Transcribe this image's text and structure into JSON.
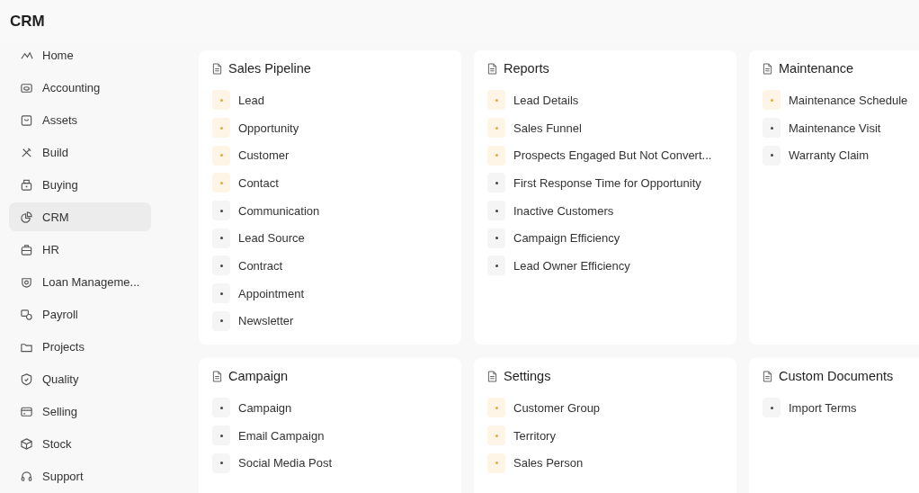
{
  "header": {
    "title": "CRM"
  },
  "sidebar": {
    "items": [
      {
        "label": "Home",
        "selected": false
      },
      {
        "label": "Accounting",
        "selected": false
      },
      {
        "label": "Assets",
        "selected": false
      },
      {
        "label": "Build",
        "selected": false
      },
      {
        "label": "Buying",
        "selected": false
      },
      {
        "label": "CRM",
        "selected": true
      },
      {
        "label": "HR",
        "selected": false
      },
      {
        "label": "Loan Manageme...",
        "selected": false
      },
      {
        "label": "Payroll",
        "selected": false
      },
      {
        "label": "Projects",
        "selected": false
      },
      {
        "label": "Quality",
        "selected": false
      },
      {
        "label": "Selling",
        "selected": false
      },
      {
        "label": "Stock",
        "selected": false
      },
      {
        "label": "Support",
        "selected": false
      }
    ]
  },
  "cards": [
    {
      "title": "Sales Pipeline",
      "links": [
        {
          "label": "Lead",
          "highlighted": true
        },
        {
          "label": "Opportunity",
          "highlighted": true
        },
        {
          "label": "Customer",
          "highlighted": true
        },
        {
          "label": "Contact",
          "highlighted": true
        },
        {
          "label": "Communication",
          "highlighted": false
        },
        {
          "label": "Lead Source",
          "highlighted": false
        },
        {
          "label": "Contract",
          "highlighted": false
        },
        {
          "label": "Appointment",
          "highlighted": false
        },
        {
          "label": "Newsletter",
          "highlighted": false
        }
      ]
    },
    {
      "title": "Reports",
      "links": [
        {
          "label": "Lead Details",
          "highlighted": true
        },
        {
          "label": "Sales Funnel",
          "highlighted": true
        },
        {
          "label": "Prospects Engaged But Not Convert...",
          "highlighted": true
        },
        {
          "label": "First Response Time for Opportunity",
          "highlighted": false
        },
        {
          "label": "Inactive Customers",
          "highlighted": false
        },
        {
          "label": "Campaign Efficiency",
          "highlighted": false
        },
        {
          "label": "Lead Owner Efficiency",
          "highlighted": false
        }
      ]
    },
    {
      "title": "Maintenance",
      "links": [
        {
          "label": "Maintenance Schedule",
          "highlighted": true
        },
        {
          "label": "Maintenance Visit",
          "highlighted": false
        },
        {
          "label": "Warranty Claim",
          "highlighted": false
        }
      ]
    },
    {
      "title": "Campaign",
      "links": [
        {
          "label": "Campaign",
          "highlighted": false
        },
        {
          "label": "Email Campaign",
          "highlighted": false
        },
        {
          "label": "Social Media Post",
          "highlighted": false
        }
      ]
    },
    {
      "title": "Settings",
      "links": [
        {
          "label": "Customer Group",
          "highlighted": true
        },
        {
          "label": "Territory",
          "highlighted": true
        },
        {
          "label": "Sales Person",
          "highlighted": true
        }
      ]
    },
    {
      "title": "Custom Documents",
      "links": [
        {
          "label": "Import Terms",
          "highlighted": false
        }
      ]
    }
  ]
}
